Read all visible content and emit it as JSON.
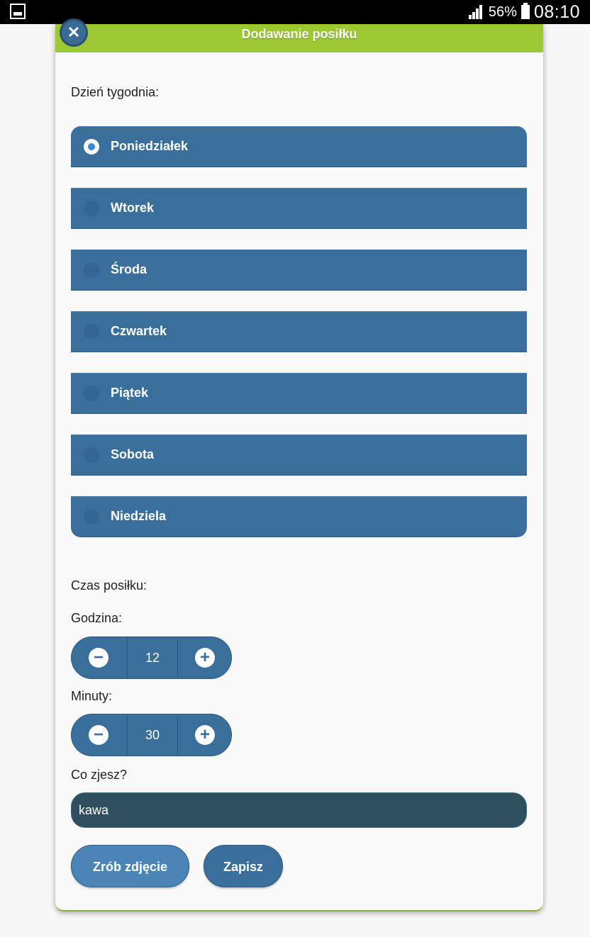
{
  "status_bar": {
    "battery_percent": "56%",
    "time": "08:10"
  },
  "dialog": {
    "title": "Dodawanie posiłku",
    "close_icon": "close-icon"
  },
  "day_section": {
    "label": "Dzień tygodnia:",
    "days": [
      "Poniedziałek",
      "Wtorek",
      "Środa",
      "Czwartek",
      "Piątek",
      "Sobota",
      "Niedziela"
    ],
    "selected_index": 0
  },
  "time_section": {
    "label": "Czas posiłku:",
    "hour_label": "Godzina:",
    "hour_value": "12",
    "minutes_label": "Minuty:",
    "minutes_value": "30"
  },
  "food_section": {
    "label": "Co zjesz?",
    "value": "kawa"
  },
  "buttons": {
    "photo": "Zrób zdjęcie",
    "save": "Zapisz"
  },
  "colors": {
    "header": "#9cc832",
    "option": "#3a6e9b",
    "input": "#2f4e5e"
  }
}
